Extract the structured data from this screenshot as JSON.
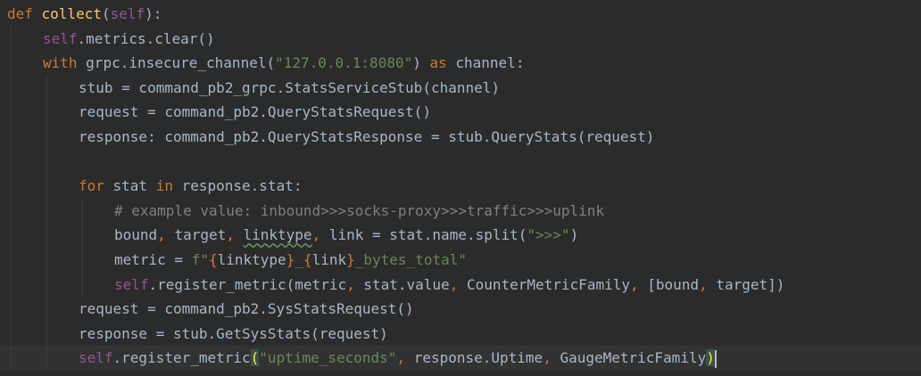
{
  "editor": {
    "lines": [
      {
        "indent": 0,
        "tokens": [
          {
            "t": "def ",
            "c": "kw"
          },
          {
            "t": "collect",
            "c": "fn"
          },
          {
            "t": "(",
            "c": ""
          },
          {
            "t": "self",
            "c": "slf"
          },
          {
            "t": "):",
            "c": ""
          }
        ]
      },
      {
        "indent": 1,
        "tokens": [
          {
            "t": "self",
            "c": "slf"
          },
          {
            "t": ".metrics.clear()",
            "c": ""
          }
        ]
      },
      {
        "indent": 1,
        "tokens": [
          {
            "t": "with ",
            "c": "kw"
          },
          {
            "t": "grpc.insecure_channel(",
            "c": ""
          },
          {
            "t": "\"127.0.0.1:8080\"",
            "c": "str"
          },
          {
            "t": ") ",
            "c": ""
          },
          {
            "t": "as ",
            "c": "kw"
          },
          {
            "t": "channel:",
            "c": ""
          }
        ]
      },
      {
        "indent": 2,
        "tokens": [
          {
            "t": "stub = command_pb2_grpc.StatsServiceStub(channel)",
            "c": ""
          }
        ]
      },
      {
        "indent": 2,
        "tokens": [
          {
            "t": "request = command_pb2.QueryStatsRequest()",
            "c": ""
          }
        ]
      },
      {
        "indent": 2,
        "tokens": [
          {
            "t": "response: command_pb2.QueryStatsResponse = stub.QueryStats(request)",
            "c": ""
          }
        ]
      },
      {
        "indent": 2,
        "blank": true,
        "tokens": []
      },
      {
        "indent": 2,
        "tokens": [
          {
            "t": "for ",
            "c": "kw"
          },
          {
            "t": "stat ",
            "c": ""
          },
          {
            "t": "in ",
            "c": "kw"
          },
          {
            "t": "response.stat:",
            "c": ""
          }
        ]
      },
      {
        "indent": 3,
        "tokens": [
          {
            "t": "# example value: inbound>>>socks-proxy>>>traffic>>>uplink",
            "c": "cmt"
          }
        ]
      },
      {
        "indent": 3,
        "tokens": [
          {
            "t": "bound",
            "c": ""
          },
          {
            "t": ", ",
            "c": "kw"
          },
          {
            "t": "target",
            "c": ""
          },
          {
            "t": ", ",
            "c": "kw"
          },
          {
            "t": "linktype",
            "c": "wavy"
          },
          {
            "t": ", ",
            "c": "kw"
          },
          {
            "t": "link = stat.name.split(",
            "c": ""
          },
          {
            "t": "\">>>\"",
            "c": "str"
          },
          {
            "t": ")",
            "c": ""
          }
        ]
      },
      {
        "indent": 3,
        "tokens": [
          {
            "t": "metric = ",
            "c": ""
          },
          {
            "t": "f\"",
            "c": "str"
          },
          {
            "t": "{",
            "c": "fs"
          },
          {
            "t": "linktype",
            "c": ""
          },
          {
            "t": "}",
            "c": "fs"
          },
          {
            "t": "_",
            "c": "str"
          },
          {
            "t": "{",
            "c": "fs"
          },
          {
            "t": "link",
            "c": ""
          },
          {
            "t": "}",
            "c": "fs"
          },
          {
            "t": "_bytes_total\"",
            "c": "str"
          }
        ]
      },
      {
        "indent": 3,
        "tokens": [
          {
            "t": "self",
            "c": "slf"
          },
          {
            "t": ".register_metric(metric",
            "c": ""
          },
          {
            "t": ", ",
            "c": "kw"
          },
          {
            "t": "stat.value",
            "c": ""
          },
          {
            "t": ", ",
            "c": "kw"
          },
          {
            "t": "CounterMetricFamily",
            "c": ""
          },
          {
            "t": ", ",
            "c": "kw"
          },
          {
            "t": "[bound",
            "c": ""
          },
          {
            "t": ", ",
            "c": "kw"
          },
          {
            "t": "target])",
            "c": ""
          }
        ]
      },
      {
        "indent": 2,
        "tokens": [
          {
            "t": "request = command_pb2.SysStatsRequest()",
            "c": ""
          }
        ]
      },
      {
        "indent": 2,
        "tokens": [
          {
            "t": "response = stub.GetSysStats(request)",
            "c": ""
          }
        ]
      },
      {
        "indent": 2,
        "current": true,
        "tokens": [
          {
            "t": "self",
            "c": "slf"
          },
          {
            "t": ".register_metric",
            "c": ""
          },
          {
            "t": "(",
            "c": "hl"
          },
          {
            "t": "\"uptime_seconds\"",
            "c": "str"
          },
          {
            "t": ", ",
            "c": "kw"
          },
          {
            "t": "response.Uptime",
            "c": ""
          },
          {
            "t": ", ",
            "c": "kw"
          },
          {
            "t": "GaugeMetricFamily",
            "c": ""
          },
          {
            "t": ")",
            "c": "hl"
          },
          {
            "t": "",
            "c": "caret"
          }
        ]
      }
    ]
  }
}
